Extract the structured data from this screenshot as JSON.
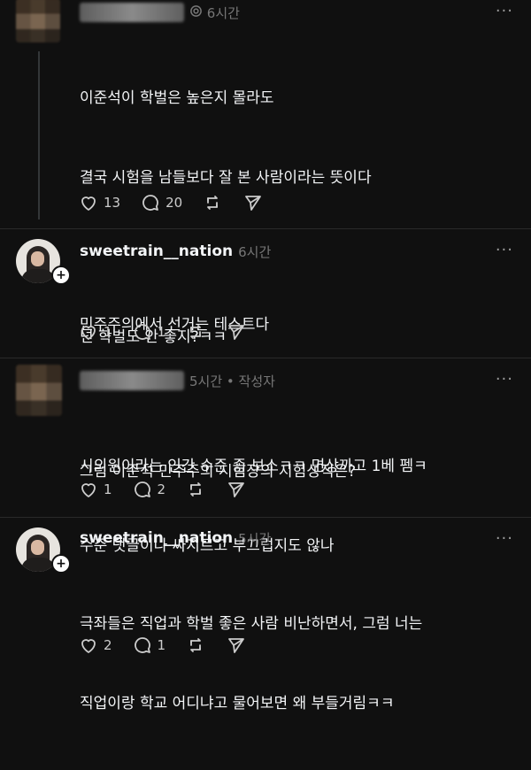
{
  "posts": [
    {
      "time": "6시간",
      "lines": [
        "이준석이 학벌은 높은지 몰라도",
        "결국 시험을 남들보다 잘 본 사람이라는 뜻이다",
        "",
        "민주주의에서 선거는 테스트다",
        "",
        "그럼 이준석 민주주의 시험장의 시험성적은?"
      ],
      "likes": "13",
      "comments": "20"
    },
    {
      "username": "sweetrain__nation",
      "time": "6시간",
      "lines": [
        "넌 학벌도 안 좋지?ㅋㅋ"
      ],
      "likes": "1",
      "comments": "1"
    },
    {
      "time": "5시간 • 작성자",
      "lines": [
        "시의원이라는 인간 수준 좀 보소ㅋㅋ 면상까고 1베 펨ㅋ",
        "수준 댓글이나 싸지르고 부끄럽지도 않나"
      ],
      "likes": "1",
      "comments": "2"
    },
    {
      "username": "sweetrain__nation",
      "time": "5시간",
      "lines": [
        "극좌들은 직업과 학벌 좋은 사람 비난하면서, 그럼 너는",
        "직업이랑 학교 어디냐고 물어보면 왜 부들거림ㅋㅋ"
      ],
      "likes": "2",
      "comments": "1"
    }
  ],
  "more_label": "···"
}
